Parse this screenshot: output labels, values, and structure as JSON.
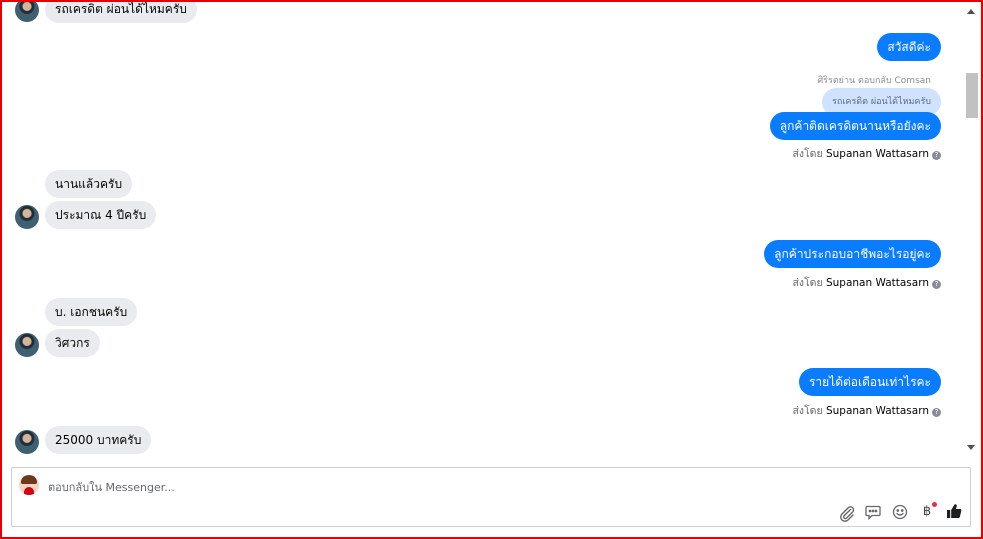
{
  "messages": {
    "m1": "รถเครดิต ผ่อนได้ไหมครับ",
    "m2": "สวัสดีค่ะ",
    "reply_hint": "ศิริรตย่าน ตอบกลับ Comsan",
    "quoted": "รถเครดิต ผ่อนได้ไหมครับ",
    "m3": "ลูกค้าติดเครดิตนานหรือยังคะ",
    "m4": "นานแล้วครับ",
    "m5": "ประมาณ 4 ปีครับ",
    "m6": "ลูกค้าประกอบอาชีพอะไรอยู่คะ",
    "m7": "บ. เอกชนครับ",
    "m8": "วิศวกร",
    "m9": "รายได้ต่อเดือนเท่าไรคะ",
    "m10": "25000 บาทครับ"
  },
  "sent_by": {
    "prefix": "ส่งโดย",
    "name": "Supanan Wattasarn",
    "help": "?"
  },
  "composer": {
    "placeholder": "ตอบกลับใน Messenger..."
  },
  "icons": [
    "attach-icon",
    "saved-replies-icon",
    "emoji-icon",
    "baht-icon",
    "like-icon"
  ],
  "tools": {
    "baht_symbol": "฿"
  },
  "colors": {
    "outgoing": "#0a7cff",
    "incoming": "#e9ebee",
    "frame": "#e60000",
    "notification": "#f02849"
  }
}
